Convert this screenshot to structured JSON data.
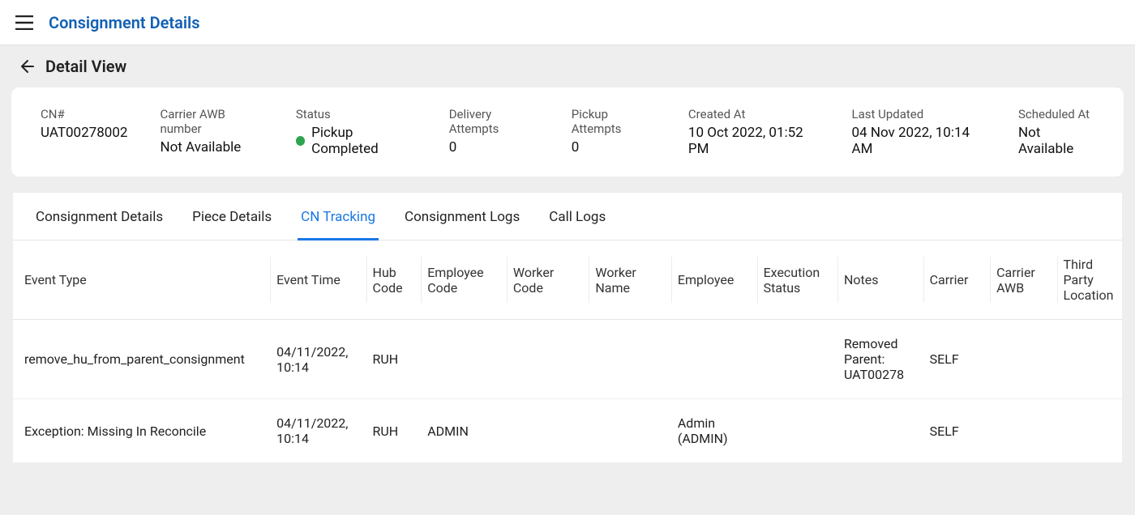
{
  "header": {
    "title": "Consignment Details"
  },
  "subheader": {
    "title": "Detail View"
  },
  "summary": {
    "cn_label": "CN#",
    "cn_value": "UAT00278002",
    "carrier_awb_label": "Carrier AWB number",
    "carrier_awb_value": "Not Available",
    "status_label": "Status",
    "status_value": "Pickup Completed",
    "status_color": "#2ea44f",
    "delivery_attempts_label": "Delivery Attempts",
    "delivery_attempts_value": "0",
    "pickup_attempts_label": "Pickup Attempts",
    "pickup_attempts_value": "0",
    "created_at_label": "Created At",
    "created_at_value": "10 Oct 2022, 01:52 PM",
    "last_updated_label": "Last Updated",
    "last_updated_value": "04 Nov 2022, 10:14 AM",
    "scheduled_at_label": "Scheduled At",
    "scheduled_at_value": "Not Available"
  },
  "tabs": {
    "items": [
      {
        "label": "Consignment Details"
      },
      {
        "label": "Piece Details"
      },
      {
        "label": "CN Tracking"
      },
      {
        "label": "Consignment Logs"
      },
      {
        "label": "Call Logs"
      }
    ],
    "active_index": 2
  },
  "table": {
    "headers": [
      "Event Type",
      "Event Time",
      "Hub Code",
      "Employee Code",
      "Worker Code",
      "Worker Name",
      "Employee",
      "Execution Status",
      "Notes",
      "Carrier",
      "Carrier AWB",
      "Third Party Location"
    ],
    "rows": [
      {
        "event_type": "remove_hu_from_parent_consignment",
        "event_time": "04/11/2022, 10:14",
        "hub_code": "RUH",
        "employee_code": "",
        "worker_code": "",
        "worker_name": "",
        "employee": "",
        "execution_status": "",
        "notes": "Removed Parent: UAT00278",
        "carrier": "SELF",
        "carrier_awb": "",
        "third_party_location": ""
      },
      {
        "event_type": "Exception: Missing In Reconcile",
        "event_time": "04/11/2022, 10:14",
        "hub_code": "RUH",
        "employee_code": "ADMIN",
        "worker_code": "",
        "worker_name": "",
        "employee": "Admin (ADMIN)",
        "execution_status": "",
        "notes": "",
        "carrier": "SELF",
        "carrier_awb": "",
        "third_party_location": ""
      }
    ]
  }
}
